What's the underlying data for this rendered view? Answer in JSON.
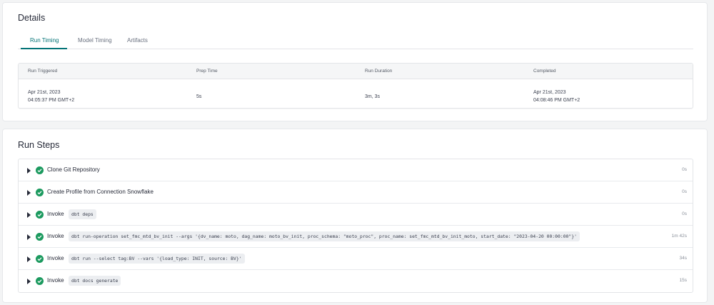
{
  "details": {
    "title": "Details",
    "tabs": [
      "Run Timing",
      "Model Timing",
      "Artifacts"
    ],
    "active_tab": "Run Timing",
    "timing": {
      "headers": [
        "Run Triggered",
        "Prep Time",
        "Run Duration",
        "Completed"
      ],
      "run_triggered": {
        "date": "Apr 21st, 2023",
        "time": "04:05:37 PM GMT+2"
      },
      "prep_time": "5s",
      "run_duration": "3m, 3s",
      "completed": {
        "date": "Apr 21st, 2023",
        "time": "04:08:46 PM GMT+2"
      }
    }
  },
  "run_steps": {
    "title": "Run Steps",
    "status_color": "#1c9a5f",
    "steps": [
      {
        "label": "Clone Git Repository",
        "command": "",
        "duration": "0s"
      },
      {
        "label": "Create Profile from Connection Snowflake",
        "command": "",
        "duration": "0s"
      },
      {
        "label": "Invoke",
        "command": "dbt deps",
        "duration": "0s"
      },
      {
        "label": "Invoke",
        "command": "dbt run-operation set_fmc_mtd_bv_init --args '{dv_name: moto, dag_name: moto_bv_init, proc_schema: \"moto_proc\", proc_name: set_fmc_mtd_bv_init_moto, start_date: \"2023-04-20 00:00:00\"}'",
        "duration": "1m 42s"
      },
      {
        "label": "Invoke",
        "command": "dbt run --select tag:BV --vars '{load_type: INIT, source: BV}'",
        "duration": "34s"
      },
      {
        "label": "Invoke",
        "command": "dbt docs generate",
        "duration": "15s"
      }
    ]
  },
  "colors": {
    "accent": "#047377",
    "background": "#f3f4f5",
    "success": "#1c9a5f"
  }
}
